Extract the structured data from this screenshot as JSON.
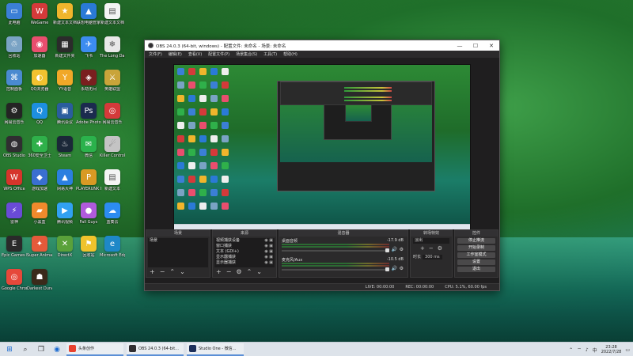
{
  "desktop_icons": [
    {
      "label": "此电脑",
      "color": "#3b7fd6",
      "glyph": "▭"
    },
    {
      "label": "WeGame",
      "color": "#d43a3a",
      "glyph": "W"
    },
    {
      "label": "新建文本文档",
      "color": "#f0b52c",
      "glyph": "★"
    },
    {
      "label": "联想电脑管家",
      "color": "#2a7ad6",
      "glyph": "▲"
    },
    {
      "label": "新建文本文档",
      "color": "#f4f4f4",
      "glyph": "▤"
    },
    {
      "label": "回收站",
      "color": "#7aa3c4",
      "glyph": "♲"
    },
    {
      "label": "加速器",
      "color": "#e94e6e",
      "glyph": "◉"
    },
    {
      "label": "新建文件夹",
      "color": "#2b2b2b",
      "glyph": "▦"
    },
    {
      "label": "飞书",
      "color": "#3c8cf0",
      "glyph": "✈"
    },
    {
      "label": "The Long Dark",
      "color": "#e8e8e8",
      "glyph": "❄"
    },
    {
      "label": "控制面板",
      "color": "#4a8ad0",
      "glyph": "⌘"
    },
    {
      "label": "QQ浏览器",
      "color": "#f2c230",
      "glyph": "◐"
    },
    {
      "label": "YY语音",
      "color": "#f1a828",
      "glyph": "Y"
    },
    {
      "label": "永劫无间",
      "color": "#7a1f1f",
      "glyph": "◈"
    },
    {
      "label": "英雄联盟",
      "color": "#c9a43a",
      "glyph": "⚔"
    },
    {
      "label": "网易云音乐",
      "color": "#242424",
      "glyph": "⚙"
    },
    {
      "label": "QQ",
      "color": "#1d8fe0",
      "glyph": "Q"
    },
    {
      "label": "腾讯会议",
      "color": "#2a5d9e",
      "glyph": "▣"
    },
    {
      "label": "Adobe Photosho...",
      "color": "#1b2a4e",
      "glyph": "Ps"
    },
    {
      "label": "网易云音乐",
      "color": "#d43a3a",
      "glyph": "◎"
    },
    {
      "label": "OBS Studio",
      "color": "#302e31",
      "glyph": "◍"
    },
    {
      "label": "360安全卫士",
      "color": "#2fb04a",
      "glyph": "✚"
    },
    {
      "label": "Steam",
      "color": "#1b2838",
      "glyph": "♨"
    },
    {
      "label": "微信",
      "color": "#2bb24c",
      "glyph": "✉"
    },
    {
      "label": "Killer Control...",
      "color": "#c4c4c4",
      "glyph": "☄"
    },
    {
      "label": "WPS Office",
      "color": "#d6342b",
      "glyph": "W"
    },
    {
      "label": "游戏加速",
      "color": "#3a6fd0",
      "glyph": "◆"
    },
    {
      "label": "网易大神",
      "color": "#2b7fe0",
      "glyph": "▲"
    },
    {
      "label": "PLAYERUNK BATTLEGR...",
      "color": "#d89a24",
      "glyph": "P"
    },
    {
      "label": "新建文本",
      "color": "#f4f4f4",
      "glyph": "▤"
    },
    {
      "label": "雷神",
      "color": "#6a4bd6",
      "glyph": "⚡"
    },
    {
      "label": "小黑盒",
      "color": "#f08a2c",
      "glyph": "▰"
    },
    {
      "label": "腾讯视频",
      "color": "#31a1f2",
      "glyph": "▶"
    },
    {
      "label": "Fall Guys",
      "color": "#b05adc",
      "glyph": "●"
    },
    {
      "label": "蓝奏云",
      "color": "#2c8cf0",
      "glyph": "☁"
    },
    {
      "label": "Epic Games Launcher",
      "color": "#2a2a2a",
      "glyph": "E"
    },
    {
      "label": "Super Animal R...",
      "color": "#e45a3a",
      "glyph": "✦"
    },
    {
      "label": "DirectX",
      "color": "#5aa13a",
      "glyph": "✕"
    },
    {
      "label": "回收站",
      "color": "#f0c32c",
      "glyph": "⚑"
    },
    {
      "label": "Microsoft Edge",
      "color": "#1e88c8",
      "glyph": "e"
    },
    {
      "label": "Google Chrome",
      "color": "#e6483a",
      "glyph": "◎"
    },
    {
      "label": "Darkest Dungeon II",
      "color": "#3a2a1a",
      "glyph": "☗"
    }
  ],
  "obs": {
    "title": "OBS 24.0.3 (64-bit, windows) - 配置文件: 未命名 - 场景: 未命名",
    "menu": [
      "文件(F)",
      "编辑(E)",
      "查看(V)",
      "配置文件(P)",
      "场景集合(S)",
      "工具(T)",
      "帮助(H)"
    ],
    "docks": {
      "scenes": {
        "title": "场景",
        "items": [
          "场景"
        ]
      },
      "sources": {
        "title": "来源",
        "items": [
          "视频捕获设备",
          "窗口捕获",
          "文本 (GDI+)",
          "显示器捕获",
          "显示器捕获"
        ]
      },
      "mixer": {
        "title": "混音器",
        "channels": [
          {
            "name": "桌面音频",
            "db": "-17.9 dB"
          },
          {
            "name": "麦克风/Aux",
            "db": "-10.5 dB"
          }
        ]
      },
      "transitions": {
        "title": "转场特效",
        "selected": "淡出",
        "duration_label": "时长",
        "duration": "300 ms"
      },
      "controls": {
        "title": "控件",
        "buttons": [
          "停止推流",
          "开始录制",
          "工作室模式",
          "设置",
          "退出"
        ]
      }
    },
    "status": {
      "live": "LIVE: 00:00:00",
      "rec": "REC: 00:00:00",
      "cpu": "CPU: 5.1%, 60.00 fps"
    }
  },
  "taskbar": {
    "apps": [
      {
        "label": "头条创作",
        "color": "#e8412e"
      },
      {
        "label": "OBS 24.0.3 (64-bit...",
        "color": "#302e31"
      },
      {
        "label": "Studio One - 微信...",
        "color": "#1c2f5a"
      }
    ],
    "clock_time": "23:28",
    "clock_date": "2022/7/28"
  }
}
